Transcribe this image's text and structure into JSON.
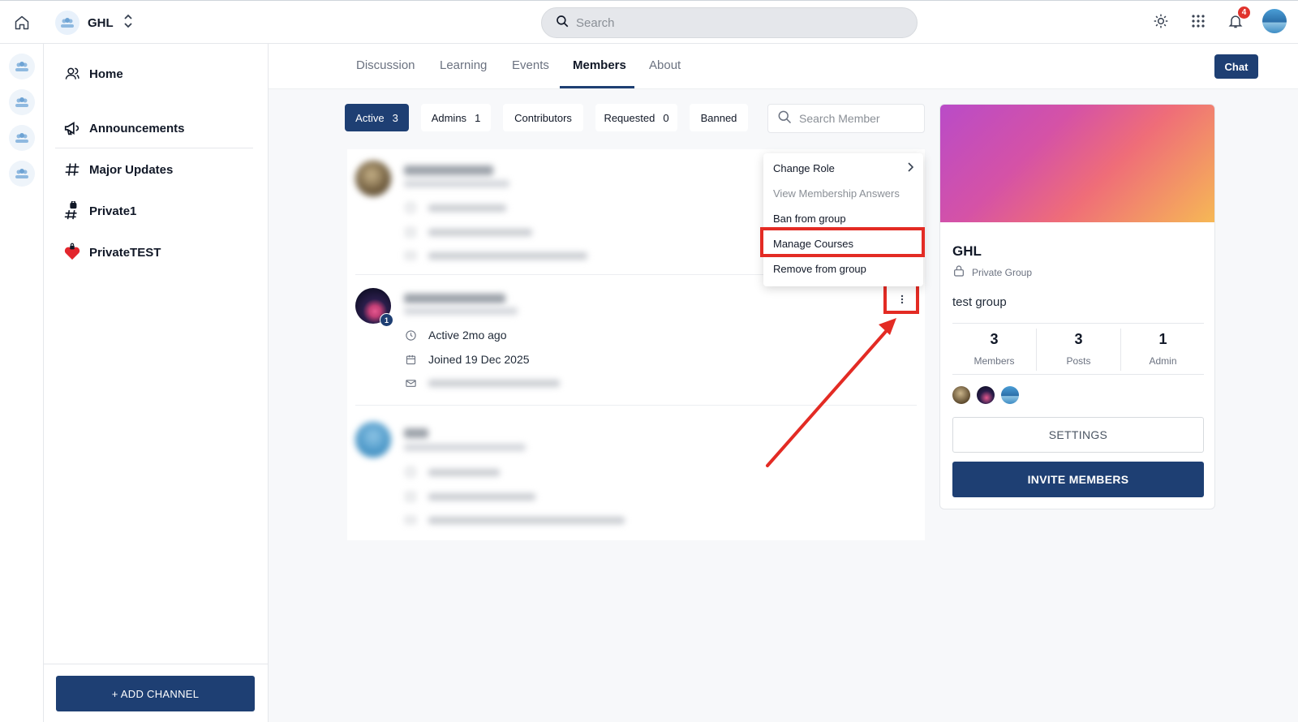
{
  "header": {
    "group_name": "GHL",
    "search_placeholder": "Search",
    "notification_count": "4"
  },
  "sidebar": {
    "items": [
      {
        "label": "Home",
        "icon": "user-icon"
      },
      {
        "label": "Announcements",
        "icon": "megaphone-icon"
      },
      {
        "label": "Major Updates",
        "icon": "hash-icon"
      },
      {
        "label": "Private1",
        "icon": "locked-hash-icon"
      },
      {
        "label": "PrivateTEST",
        "icon": "heart-icon"
      }
    ],
    "add_channel_label": "+ ADD CHANNEL"
  },
  "tabs": [
    {
      "label": "Discussion"
    },
    {
      "label": "Learning"
    },
    {
      "label": "Events"
    },
    {
      "label": "Members",
      "active": true
    },
    {
      "label": "About"
    }
  ],
  "chat_label": "Chat",
  "filters": [
    {
      "label": "Active",
      "count": "3",
      "active": true
    },
    {
      "label": "Admins",
      "count": "1"
    },
    {
      "label": "Contributors",
      "count": ""
    },
    {
      "label": "Requested",
      "count": "0"
    },
    {
      "label": "Banned",
      "count": ""
    }
  ],
  "member_search_placeholder": "Search Member",
  "focused_member": {
    "role_badge": "1",
    "active": "Active 2mo ago",
    "joined": "Joined 19 Dec 2025"
  },
  "context_menu": [
    {
      "label": "Change Role",
      "has_submenu": true
    },
    {
      "label": "View Membership Answers",
      "disabled": true
    },
    {
      "label": "Ban from group"
    },
    {
      "label": "Manage Courses",
      "highlighted": true
    },
    {
      "label": "Remove from group"
    }
  ],
  "group_card": {
    "title": "GHL",
    "privacy": "Private Group",
    "description": "test group",
    "stats": [
      {
        "value": "3",
        "label": "Members"
      },
      {
        "value": "3",
        "label": "Posts"
      },
      {
        "value": "1",
        "label": "Admin"
      }
    ],
    "settings_label": "SETTINGS",
    "invite_label": "INVITE MEMBERS"
  },
  "colors": {
    "primary": "#1e3f73",
    "highlight": "#e32b24",
    "badge": "#e0332d"
  }
}
